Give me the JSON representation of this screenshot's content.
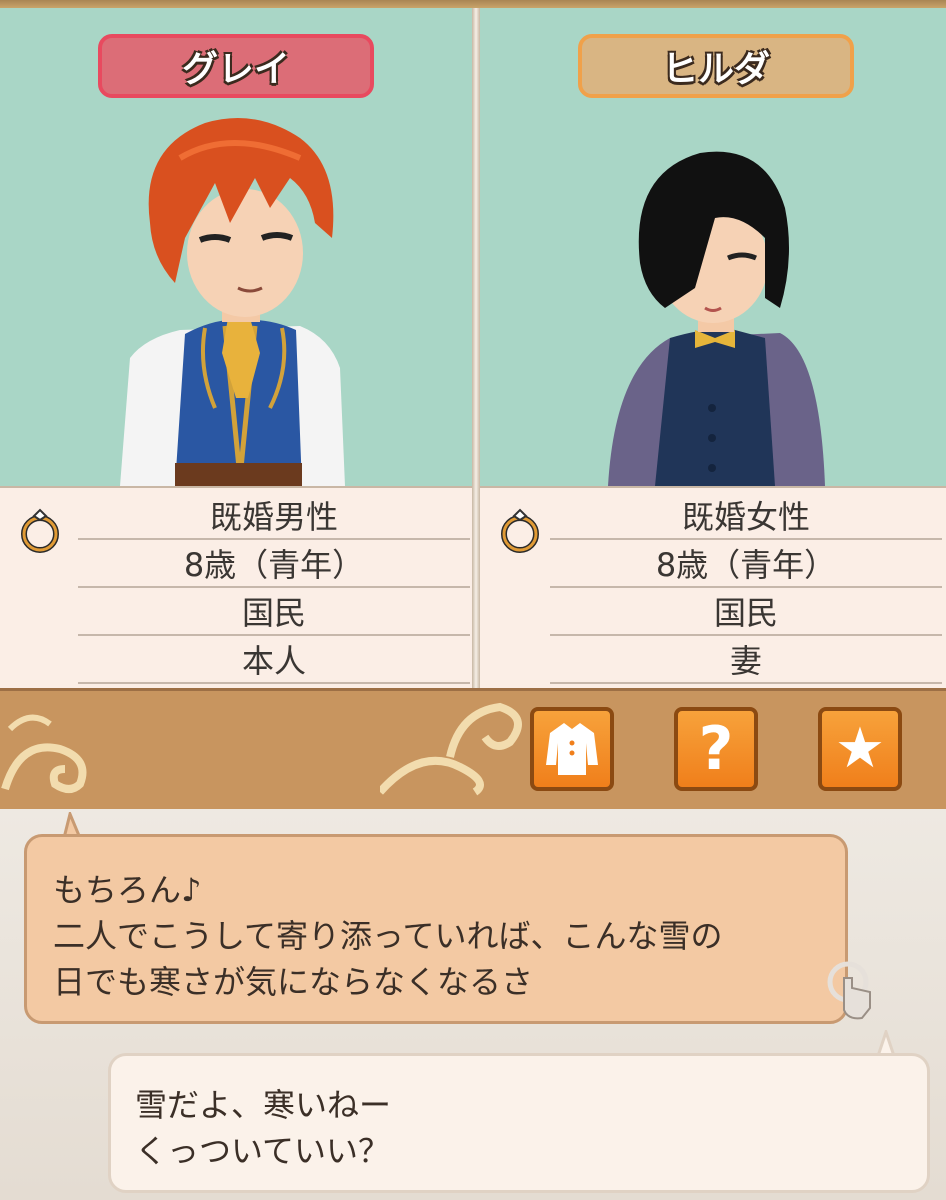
{
  "characters": [
    {
      "name": "グレイ",
      "status": [
        "既婚男性",
        "8歳（青年）",
        "国民",
        "本人"
      ]
    },
    {
      "name": "ヒルダ",
      "status": [
        "既婚女性",
        "8歳（青年）",
        "国民",
        "妻"
      ]
    }
  ],
  "toolbar": {
    "buttons": [
      {
        "icon": "outfit-icon"
      },
      {
        "icon": "question-icon",
        "glyph": "?"
      },
      {
        "icon": "star-icon",
        "glyph": "★"
      }
    ]
  },
  "dialog": {
    "npc_lines": [
      "もちろん♪",
      "二人でこうして寄り添っていれば、こんな雪の",
      "日でも寒さが気にならなくなるさ"
    ],
    "player_lines": [
      "雪だよ、寒いねー",
      "くっついていい？"
    ]
  },
  "colors": {
    "panel_bg": "#a9d6c6",
    "name_left_bg": "#dc6d77",
    "name_right_bg": "#d9b583",
    "toolbar_bg": "#c8955f",
    "button_orange": "#f28a24",
    "npc_bubble": "#f3c9a3",
    "player_bubble": "#fbf2ea"
  }
}
